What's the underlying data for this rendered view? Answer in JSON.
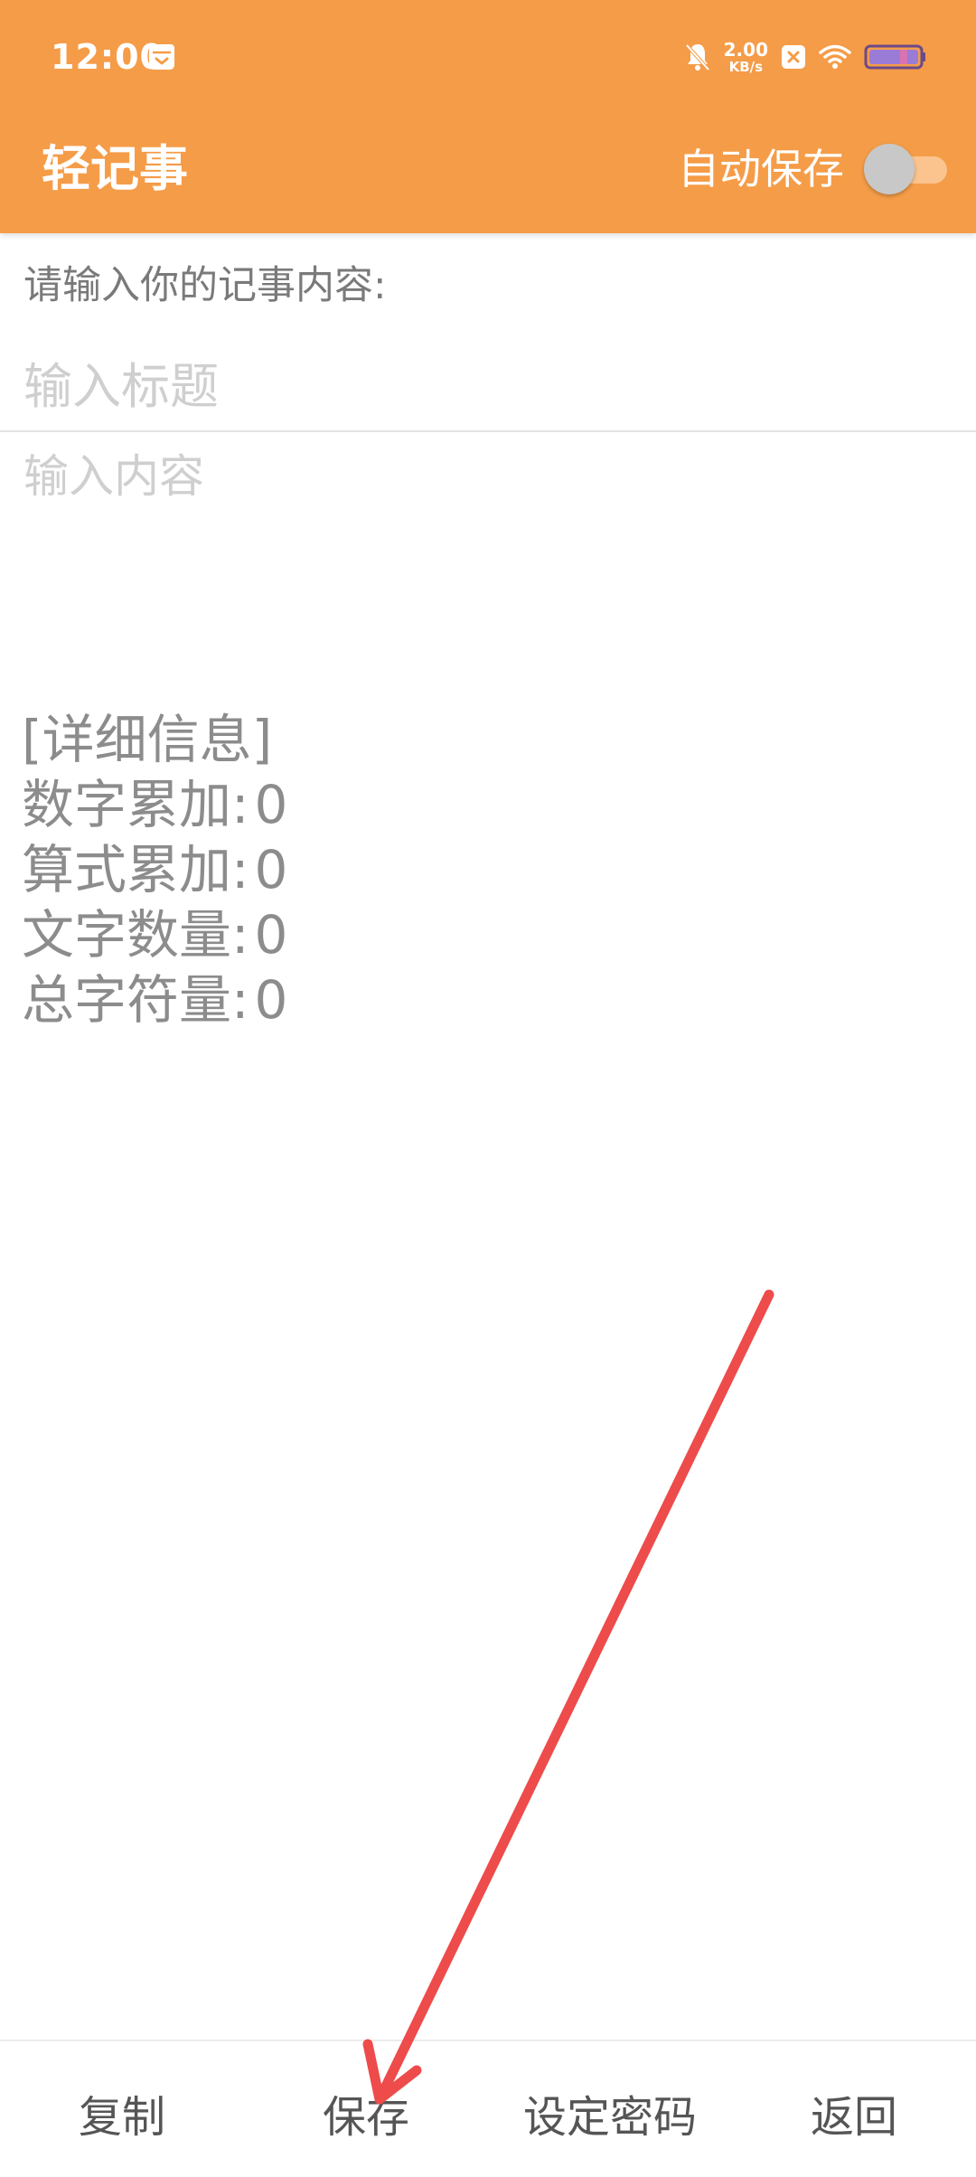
{
  "status_bar": {
    "time": "12:00",
    "net_speed_value": "2.00",
    "net_speed_unit": "KB/s",
    "icons": [
      "calendar-icon",
      "bell-muted-icon",
      "close-box-icon",
      "wifi-icon",
      "battery-icon"
    ]
  },
  "app_bar": {
    "title": "轻记事",
    "autosave_label": "自动保存",
    "autosave_on": false
  },
  "editor": {
    "prompt_label": "请输入你的记事内容:",
    "title_placeholder": "输入标题",
    "title_value": "",
    "content_placeholder": "输入内容",
    "content_value": ""
  },
  "details": {
    "heading": "[详细信息]",
    "rows": [
      {
        "label": "数字累加:",
        "value": "0"
      },
      {
        "label": "算式累加:",
        "value": "0"
      },
      {
        "label": "文字数量:",
        "value": "0"
      },
      {
        "label": "总字符量:",
        "value": "0"
      }
    ]
  },
  "bottom_bar": {
    "copy_label": "复制",
    "save_label": "保存",
    "password_label": "设定密码",
    "back_label": "返回"
  },
  "colors": {
    "accent": "#F59C48",
    "annotation": "#EE4B4B"
  }
}
